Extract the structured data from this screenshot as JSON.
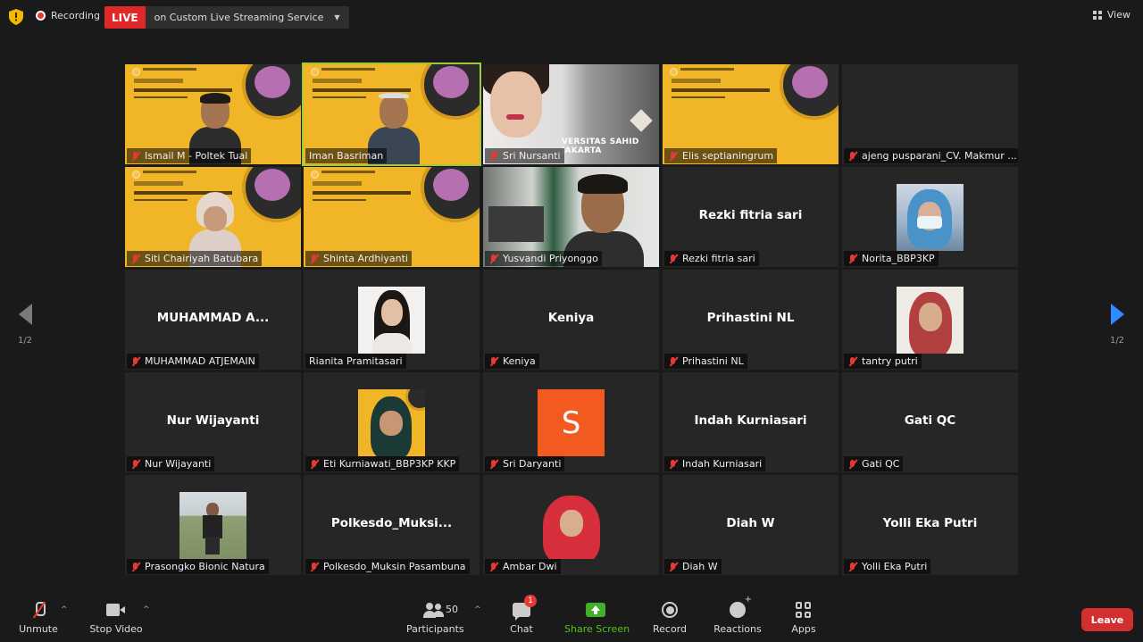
{
  "topbar": {
    "recording_label": "Recording",
    "live_badge": "LIVE",
    "live_service": "on Custom Live Streaming Service",
    "view_label": "View"
  },
  "pagination": {
    "left": "1/2",
    "right": "1/2"
  },
  "tiles": [
    {
      "name": "Ismail M - Poltek Tual",
      "display": "",
      "muted": true
    },
    {
      "name": "Iman Basriman",
      "display": "",
      "muted": false,
      "active": true
    },
    {
      "name": "Sri Nursanti",
      "display": "",
      "muted": true,
      "overlay_text": "VERSITAS SAHID JAKARTA"
    },
    {
      "name": "Elis septianingrum",
      "display": "",
      "muted": true
    },
    {
      "name": "ajeng pusparani_CV. Makmur ...",
      "display": "",
      "muted": true
    },
    {
      "name": "Siti Chairiyah Batubara",
      "display": "",
      "muted": true
    },
    {
      "name": "Shinta Ardhiyanti",
      "display": "",
      "muted": true
    },
    {
      "name": "Yusvandi Priyonggo",
      "display": "",
      "muted": true
    },
    {
      "name": "Rezki fitria sari",
      "display": "Rezki fitria sari",
      "muted": true
    },
    {
      "name": "Norita_BBP3KP",
      "display": "",
      "muted": true
    },
    {
      "name": "MUHAMMAD ATJEMAIN",
      "display": "MUHAMMAD A...",
      "muted": true
    },
    {
      "name": "Rianita Pramitasari",
      "display": "",
      "muted": false
    },
    {
      "name": "Keniya",
      "display": "Keniya",
      "muted": true
    },
    {
      "name": "Prihastini NL",
      "display": "Prihastini NL",
      "muted": true
    },
    {
      "name": "tantry putri",
      "display": "",
      "muted": true
    },
    {
      "name": "Nur Wijayanti",
      "display": "Nur Wijayanti",
      "muted": true
    },
    {
      "name": "Eti Kurniawati_BBP3KP KKP",
      "display": "",
      "muted": true
    },
    {
      "name": "Sri Daryanti",
      "display": "",
      "muted": true,
      "avatar_letter": "S"
    },
    {
      "name": "Indah Kurniasari",
      "display": "Indah Kurniasari",
      "muted": true
    },
    {
      "name": "Gati QC",
      "display": "Gati QC",
      "muted": true
    },
    {
      "name": "Prasongko Bionic Natura",
      "display": "",
      "muted": true
    },
    {
      "name": "Polkesdo_Muksin Pasambuna",
      "display": "Polkesdo_Muksi...",
      "muted": true
    },
    {
      "name": "Ambar Dwi",
      "display": "",
      "muted": true
    },
    {
      "name": "Diah W",
      "display": "Diah W",
      "muted": true
    },
    {
      "name": "Yolli Eka Putri",
      "display": "Yolli Eka Putri",
      "muted": true
    }
  ],
  "toolbar": {
    "unmute": "Unmute",
    "stop_video": "Stop Video",
    "participants": "Participants",
    "participants_count": "50",
    "chat": "Chat",
    "chat_badge": "1",
    "share_screen": "Share Screen",
    "record": "Record",
    "reactions": "Reactions",
    "apps": "Apps",
    "leave": "Leave"
  },
  "colors": {
    "background": "#1a1a1a",
    "tile": "#262626",
    "live_red": "#e02828",
    "active_speaker": "#9ccc3a",
    "share_green": "#43b02a",
    "leave_red": "#d32f2f",
    "arrow_blue": "#2d8cff"
  }
}
